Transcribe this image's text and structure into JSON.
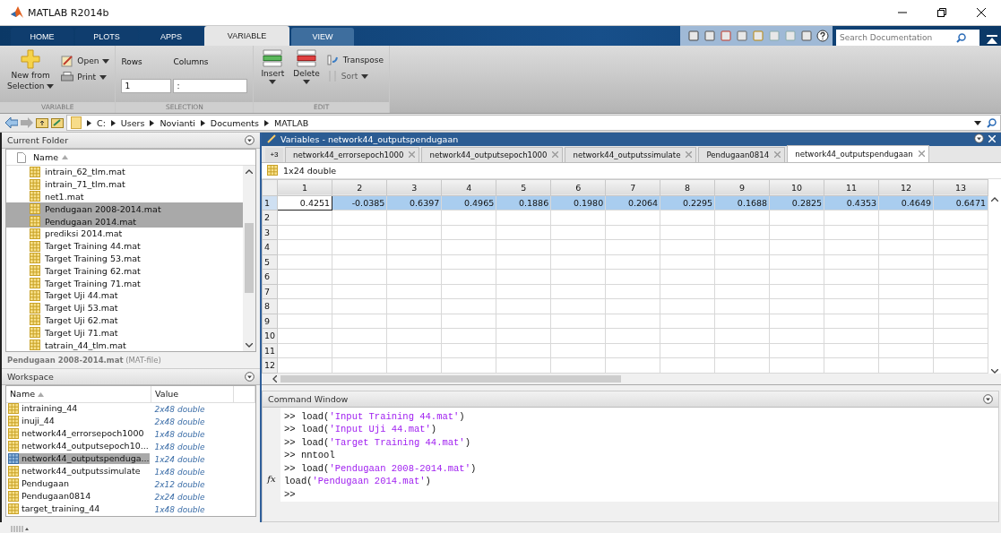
{
  "window": {
    "title": "MATLAB R2014b"
  },
  "ribbon_tabs": [
    {
      "label": "HOME",
      "selected": false
    },
    {
      "label": "PLOTS",
      "selected": false
    },
    {
      "label": "APPS",
      "selected": false
    },
    {
      "label": "VARIABLE",
      "selected": true
    },
    {
      "label": "VIEW",
      "selected": false
    }
  ],
  "search": {
    "placeholder": "Search Documentation"
  },
  "toolstrip": {
    "sections": [
      {
        "label": "VARIABLE",
        "kind": "variable",
        "new_button": [
          "New from",
          "Selection"
        ],
        "open": "Open",
        "print": "Print"
      },
      {
        "label": "SELECTION",
        "kind": "selection",
        "rows_label": "Rows",
        "rows_value": "1",
        "columns_label": "Columns",
        "columns_value": ":"
      },
      {
        "label": "EDIT",
        "kind": "edit",
        "insert": "Insert",
        "delete": "Delete",
        "transpose": "Transpose",
        "sort": "Sort",
        "sort_disabled": true
      }
    ]
  },
  "address": [
    "C:",
    "Users",
    "Novianti",
    "Documents",
    "MATLAB"
  ],
  "current_folder": {
    "title": "Current Folder",
    "column": "Name",
    "files": [
      {
        "name": "intrain_62_tlm.mat",
        "selected": false
      },
      {
        "name": "intrain_71_tlm.mat",
        "selected": false
      },
      {
        "name": "net1.mat",
        "selected": false
      },
      {
        "name": "Pendugaan 2008-2014.mat",
        "selected": true
      },
      {
        "name": "Pendugaan 2014.mat",
        "selected": true
      },
      {
        "name": "prediksi 2014.mat",
        "selected": false
      },
      {
        "name": "Target Training 44.mat",
        "selected": false
      },
      {
        "name": "Target Training 53.mat",
        "selected": false
      },
      {
        "name": "Target Training 62.mat",
        "selected": false
      },
      {
        "name": "Target Training 71.mat",
        "selected": false
      },
      {
        "name": "Target Uji 44.mat",
        "selected": false
      },
      {
        "name": "Target Uji 53.mat",
        "selected": false
      },
      {
        "name": "Target Uji 62.mat",
        "selected": false
      },
      {
        "name": "Target Uji 71.mat",
        "selected": false
      },
      {
        "name": "tatrain_44_tlm.mat",
        "selected": false
      }
    ],
    "details": "**Pendugaan 2008-2014.mat** (MAT-file)"
  },
  "workspace": {
    "title": "Workspace",
    "columns": [
      "Name",
      "Value"
    ],
    "variables": [
      {
        "name": "intraining_44",
        "value": "2x48 double",
        "selected": false
      },
      {
        "name": "inuji_44",
        "value": "2x48 double",
        "selected": false
      },
      {
        "name": "network44_errorsepoch1000",
        "value": "1x48 double",
        "selected": false
      },
      {
        "name": "network44_outputsepoch10...",
        "value": "1x48 double",
        "selected": false
      },
      {
        "name": "network44_outputspenduga...",
        "value": "1x24 double",
        "selected": true
      },
      {
        "name": "network44_outputssimulate",
        "value": "1x48 double",
        "selected": false
      },
      {
        "name": "Pendugaan",
        "value": "2x12 double",
        "selected": false
      },
      {
        "name": "Pendugaan0814",
        "value": "2x24 double",
        "selected": false
      },
      {
        "name": "target_training_44",
        "value": "1x48 double",
        "selected": false
      }
    ]
  },
  "variables": {
    "title": "Variables - network44_outputspendugaan",
    "overflow": "+3",
    "tabs": [
      {
        "label": "network44_errorsepoch1000",
        "selected": false
      },
      {
        "label": "network44_outputsepoch1000",
        "selected": false
      },
      {
        "label": "network44_outputssimulate",
        "selected": false
      },
      {
        "label": "Pendugaan0814",
        "selected": false
      },
      {
        "label": "network44_outputspendugaan",
        "selected": true
      }
    ],
    "info": "1x24 double",
    "columns": [
      "1",
      "2",
      "3",
      "4",
      "5",
      "6",
      "7",
      "8",
      "9",
      "10",
      "11",
      "12",
      "13"
    ],
    "rows": [
      {
        "label": "1",
        "selected": true,
        "cells": [
          {
            "value": "0.4251",
            "active": true
          },
          {
            "value": "-0.0385",
            "active": false
          },
          {
            "value": "0.6397",
            "active": false
          },
          {
            "value": "0.4965",
            "active": false
          },
          {
            "value": "0.1886",
            "active": false
          },
          {
            "value": "0.1980",
            "active": false
          },
          {
            "value": "0.2064",
            "active": false
          },
          {
            "value": "0.2295",
            "active": false
          },
          {
            "value": "0.1688",
            "active": false
          },
          {
            "value": "0.2825",
            "active": false
          },
          {
            "value": "0.4353",
            "active": false
          },
          {
            "value": "0.4649",
            "active": false
          },
          {
            "value": "0.6471",
            "active": false
          }
        ]
      },
      {
        "label": "2",
        "selected": false,
        "cells": []
      },
      {
        "label": "3",
        "selected": false,
        "cells": []
      },
      {
        "label": "4",
        "selected": false,
        "cells": []
      },
      {
        "label": "5",
        "selected": false,
        "cells": []
      },
      {
        "label": "6",
        "selected": false,
        "cells": []
      },
      {
        "label": "7",
        "selected": false,
        "cells": []
      },
      {
        "label": "8",
        "selected": false,
        "cells": []
      },
      {
        "label": "9",
        "selected": false,
        "cells": []
      },
      {
        "label": "10",
        "selected": false,
        "cells": []
      },
      {
        "label": "11",
        "selected": false,
        "cells": []
      },
      {
        "label": "12",
        "selected": false,
        "cells": []
      }
    ]
  },
  "command_window": {
    "title": "Command Window",
    "fx": "fx",
    "lines": [
      {
        "parts": [
          {
            "kind": "code",
            "text": ">> load("
          },
          {
            "kind": "string",
            "text": "'Input Training 44.mat'"
          },
          {
            "kind": "code",
            "text": ")"
          }
        ]
      },
      {
        "parts": [
          {
            "kind": "code",
            "text": ">> load("
          },
          {
            "kind": "string",
            "text": "'Input Uji 44.mat'"
          },
          {
            "kind": "code",
            "text": ")"
          }
        ]
      },
      {
        "parts": [
          {
            "kind": "code",
            "text": ">> load("
          },
          {
            "kind": "string",
            "text": "'Target Training 44.mat'"
          },
          {
            "kind": "code",
            "text": ")"
          }
        ]
      },
      {
        "parts": [
          {
            "kind": "code",
            "text": ">> nntool"
          }
        ]
      },
      {
        "parts": [
          {
            "kind": "code",
            "text": ">> load("
          },
          {
            "kind": "string",
            "text": "'Pendugaan 2008-2014.mat'"
          },
          {
            "kind": "code",
            "text": ")"
          }
        ]
      },
      {
        "parts": [
          {
            "kind": "code",
            "text": "load("
          },
          {
            "kind": "string",
            "text": "'Pendugaan 2014.mat'"
          },
          {
            "kind": "code",
            "text": ")"
          }
        ]
      },
      {
        "parts": [
          {
            "kind": "code",
            "text": ">>"
          }
        ]
      }
    ]
  }
}
